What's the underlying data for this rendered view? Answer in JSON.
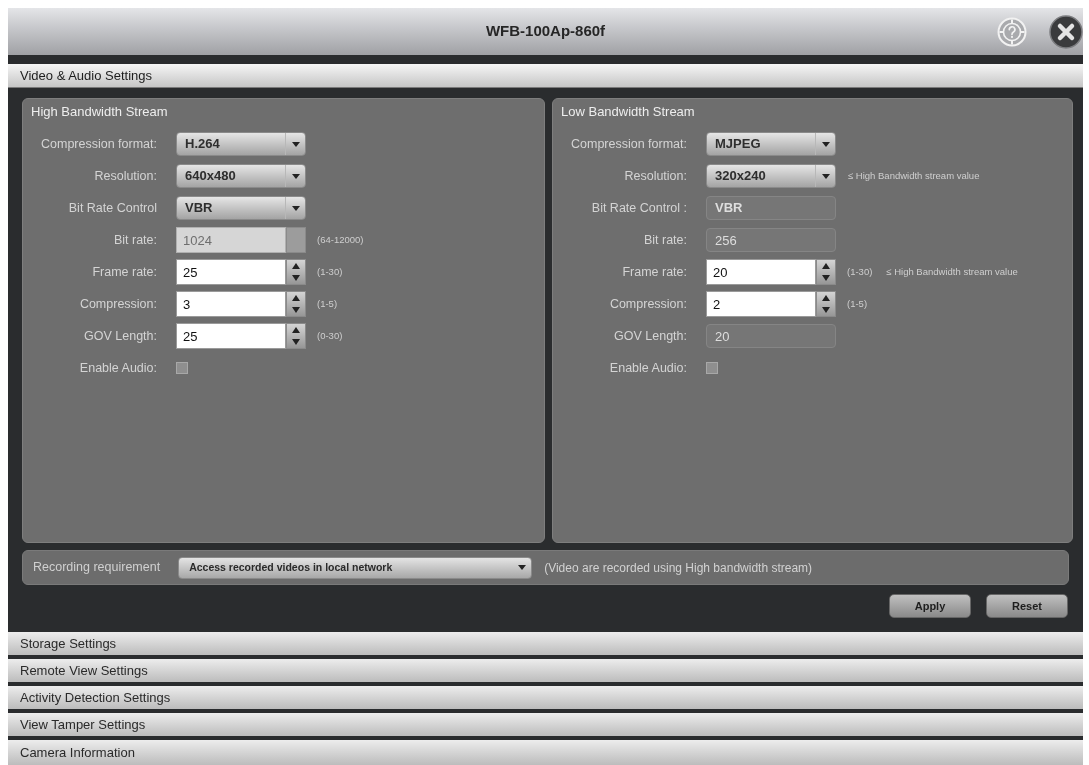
{
  "window": {
    "title": "WFB-100Ap-860f"
  },
  "sections": [
    {
      "title": "Video & Audio Settings",
      "expanded": true,
      "streams": [
        {
          "title": "High Bandwidth Stream",
          "fields": [
            {
              "label": "Compression format:",
              "kind": "select",
              "value": "H.264",
              "disabled": false
            },
            {
              "label": "Resolution:",
              "kind": "select",
              "value": "640x480",
              "disabled": false
            },
            {
              "label": "Bit Rate Control",
              "kind": "select",
              "value": "VBR",
              "disabled": false
            },
            {
              "label": "Bit rate:",
              "kind": "spin",
              "value": "1024",
              "disabled": true,
              "range": "(64-12000)"
            },
            {
              "label": "Frame rate:",
              "kind": "spin",
              "value": "25",
              "disabled": false,
              "range": "(1-30)"
            },
            {
              "label": "Compression:",
              "kind": "spin",
              "value": "3",
              "disabled": false,
              "range": "(1-5)"
            },
            {
              "label": "GOV Length:",
              "kind": "spin",
              "value": "25",
              "disabled": false,
              "range": "(0-30)"
            },
            {
              "label": "Enable Audio:",
              "kind": "checkbox",
              "checked": false,
              "disabled": false
            }
          ]
        },
        {
          "title": "Low Bandwidth Stream",
          "fields": [
            {
              "label": "Compression format:",
              "kind": "select",
              "value": "MJPEG",
              "disabled": false
            },
            {
              "label": "Resolution:",
              "kind": "select",
              "value": "320x240",
              "disabled": false,
              "note": "≤ High Bandwidth stream value"
            },
            {
              "label": "Bit Rate Control :",
              "kind": "select",
              "value": "VBR",
              "disabled": true
            },
            {
              "label": "Bit rate:",
              "kind": "text",
              "value": "256",
              "disabled": true
            },
            {
              "label": "Frame rate:",
              "kind": "spin",
              "value": "20",
              "disabled": false,
              "range": "(1-30)",
              "note": "≤ High Bandwidth stream value"
            },
            {
              "label": "Compression:",
              "kind": "spin",
              "value": "2",
              "disabled": false,
              "range": "(1-5)"
            },
            {
              "label": "GOV Length:",
              "kind": "text",
              "value": "20",
              "disabled": true
            },
            {
              "label": "Enable Audio:",
              "kind": "checkbox",
              "checked": false,
              "disabled": false
            }
          ]
        }
      ],
      "recording": {
        "label": "Recording requirement",
        "value": "Access recorded videos in local network",
        "note": "(Video are recorded using High bandwidth stream)"
      },
      "buttons": [
        "Apply",
        "Reset"
      ]
    },
    {
      "title": "Storage Settings",
      "expanded": false
    },
    {
      "title": "Remote View Settings",
      "expanded": false
    },
    {
      "title": "Activity Detection Settings",
      "expanded": false
    },
    {
      "title": "View Tamper Settings",
      "expanded": false
    },
    {
      "title": "Camera Information",
      "expanded": false
    }
  ]
}
